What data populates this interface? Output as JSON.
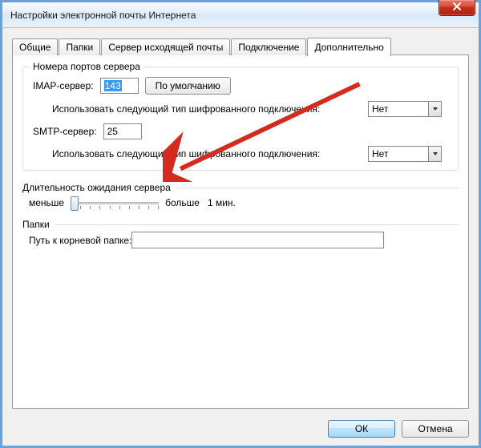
{
  "window": {
    "title": "Настройки электронной почты Интернета"
  },
  "tabs": {
    "general": "Общие",
    "folders": "Папки",
    "outgoing": "Сервер исходящей почты",
    "connection": "Подключение",
    "advanced": "Дополнительно"
  },
  "group_ports": {
    "legend": "Номера портов сервера",
    "imap_label": "IMAP-сервер:",
    "imap_port": "143",
    "default_btn": "По умолчанию",
    "enc_label": "Использовать следующий тип шифрованного подключения:",
    "imap_enc": "Нет",
    "smtp_label": "SMTP-сервер:",
    "smtp_port": "25",
    "smtp_enc": "Нет"
  },
  "group_timeout": {
    "legend": "Длительность ожидания сервера",
    "min": "меньше",
    "max": "больше",
    "value": "1 мин."
  },
  "group_folders": {
    "legend": "Папки",
    "root_label": "Путь к корневой папке:",
    "root_value": ""
  },
  "footer": {
    "ok": "ОК",
    "cancel": "Отмена"
  },
  "icons": {
    "close": "close-icon",
    "dropdown": "chevron-down-icon"
  }
}
